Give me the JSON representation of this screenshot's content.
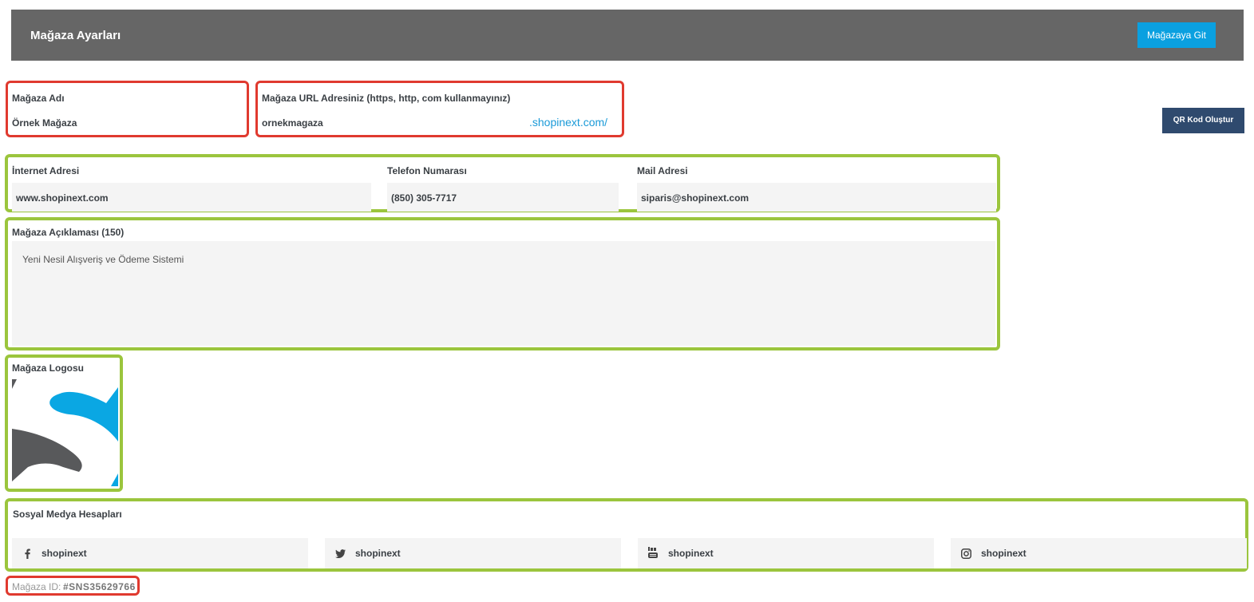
{
  "header": {
    "title": "Mağaza Ayarları",
    "goto_button": "Mağazaya Git"
  },
  "store_name": {
    "label": "Mağaza Adı",
    "value": "Örnek Mağaza"
  },
  "store_url": {
    "label": "Mağaza URL Adresiniz (https, http, com kullanmayınız)",
    "value": "ornekmagaza",
    "suffix": ".shopinext.com/"
  },
  "qr_button": "QR Kod Oluştur",
  "contact": {
    "website": {
      "label": "İnternet Adresi",
      "value": "www.shopinext.com"
    },
    "phone": {
      "label": "Telefon Numarası",
      "value": "(850) 305-7717"
    },
    "email": {
      "label": "Mail Adresi",
      "value": "siparis@shopinext.com"
    }
  },
  "description": {
    "label": "Mağaza Açıklaması (150)",
    "value": "Yeni Nesil Alışveriş ve Ödeme Sistemi"
  },
  "logo": {
    "label": "Mağaza Logosu"
  },
  "social": {
    "label": "Sosyal Medya Hesapları",
    "items": [
      {
        "icon": "facebook-icon",
        "value": "shopinext"
      },
      {
        "icon": "twitter-icon",
        "value": "shopinext"
      },
      {
        "icon": "youtube-icon",
        "value": "shopinext"
      },
      {
        "icon": "instagram-icon",
        "value": "shopinext"
      }
    ]
  },
  "store_id": {
    "label": "Mağaza ID:",
    "value": "#SNS35629766"
  },
  "colors": {
    "header_bg": "#666666",
    "accent_blue": "#0aa0e0",
    "qr_button_bg": "#2f4a6e",
    "highlight_red": "#e03a2f",
    "highlight_green": "#9bc53d"
  }
}
